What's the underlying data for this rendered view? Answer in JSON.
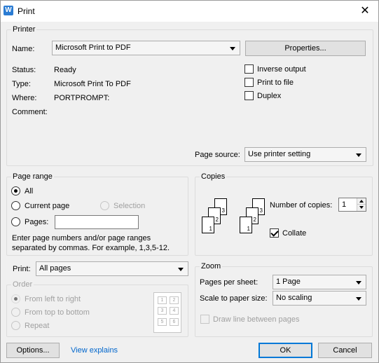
{
  "window": {
    "title": "Print",
    "app_icon_letter": "W"
  },
  "printer": {
    "group_label": "Printer",
    "name_label": "Name:",
    "name_value": "Microsoft Print to PDF",
    "properties_button": "Properties...",
    "status_label": "Status:",
    "status_value": "Ready",
    "type_label": "Type:",
    "type_value": "Microsoft Print To PDF",
    "where_label": "Where:",
    "where_value": "PORTPROMPT:",
    "comment_label": "Comment:",
    "inverse_output": "Inverse output",
    "print_to_file": "Print to file",
    "duplex": "Duplex",
    "page_source_label": "Page source:",
    "page_source_value": "Use printer setting"
  },
  "page_range": {
    "group_label": "Page range",
    "all": "All",
    "current_page": "Current page",
    "selection": "Selection",
    "pages": "Pages:",
    "help_line1": "Enter page numbers and/or page ranges",
    "help_line2": "separated by commas. For example, 1,3,5-12."
  },
  "print_what": {
    "label": "Print:",
    "value": "All pages"
  },
  "order": {
    "group_label": "Order",
    "left_to_right": "From left to right",
    "top_to_bottom": "From top to bottom",
    "repeat": "Repeat",
    "cells": [
      "1",
      "2",
      "3",
      "4",
      "5",
      "6"
    ]
  },
  "copies": {
    "group_label": "Copies",
    "number_label": "Number of copies:",
    "number_value": "1",
    "collate": "Collate",
    "page_labels": [
      "1",
      "2",
      "3"
    ]
  },
  "zoom": {
    "group_label": "Zoom",
    "pages_per_sheet_label": "Pages per sheet:",
    "pages_per_sheet_value": "1 Page",
    "scale_label": "Scale to paper size:",
    "scale_value": "No scaling",
    "draw_lines": "Draw line between pages"
  },
  "footer": {
    "options_button": "Options...",
    "view_explains_link": "View explains",
    "ok_button": "OK",
    "cancel_button": "Cancel"
  },
  "colors": {
    "accent": "#0078d7",
    "link": "#0066cc",
    "app_icon": "#2b7cd3"
  }
}
